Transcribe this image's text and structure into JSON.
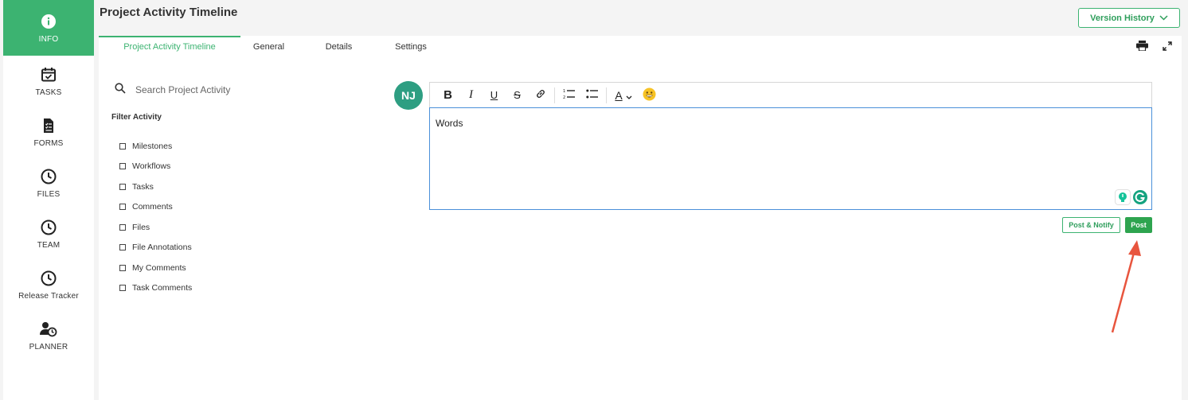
{
  "header": {
    "title": "Project Activity Timeline",
    "version_button": "Version History"
  },
  "sidebar": {
    "items": [
      {
        "label": "INFO",
        "icon": "info-icon"
      },
      {
        "label": "TASKS",
        "icon": "calendar-check-icon"
      },
      {
        "label": "FORMS",
        "icon": "form-document-icon"
      },
      {
        "label": "FILES",
        "icon": "clock-icon"
      },
      {
        "label": "TEAM",
        "icon": "clock-icon"
      },
      {
        "label": "Release Tracker",
        "icon": "clock-icon"
      },
      {
        "label": "PLANNER",
        "icon": "user-clock-icon"
      }
    ]
  },
  "tabs": [
    {
      "label": "Project Activity Timeline"
    },
    {
      "label": "General"
    },
    {
      "label": "Details"
    },
    {
      "label": "Settings"
    }
  ],
  "search": {
    "placeholder": "Search Project Activity"
  },
  "filter": {
    "title": "Filter Activity",
    "items": [
      "Milestones",
      "Workflows",
      "Tasks",
      "Comments",
      "Files",
      "File Annotations",
      "My Comments",
      "Task Comments"
    ]
  },
  "editor": {
    "avatar": "NJ",
    "content": "Words",
    "toolbar": {
      "bold": "B",
      "italic": "I",
      "underline": "U",
      "strike": "S",
      "font_color": "A"
    },
    "post_notify_label": "Post & Notify",
    "post_label": "Post"
  },
  "colors": {
    "accent": "#3cb371",
    "post": "#2ea44f",
    "avatar": "#2e9e82",
    "annotation_arrow": "#e8553e"
  }
}
